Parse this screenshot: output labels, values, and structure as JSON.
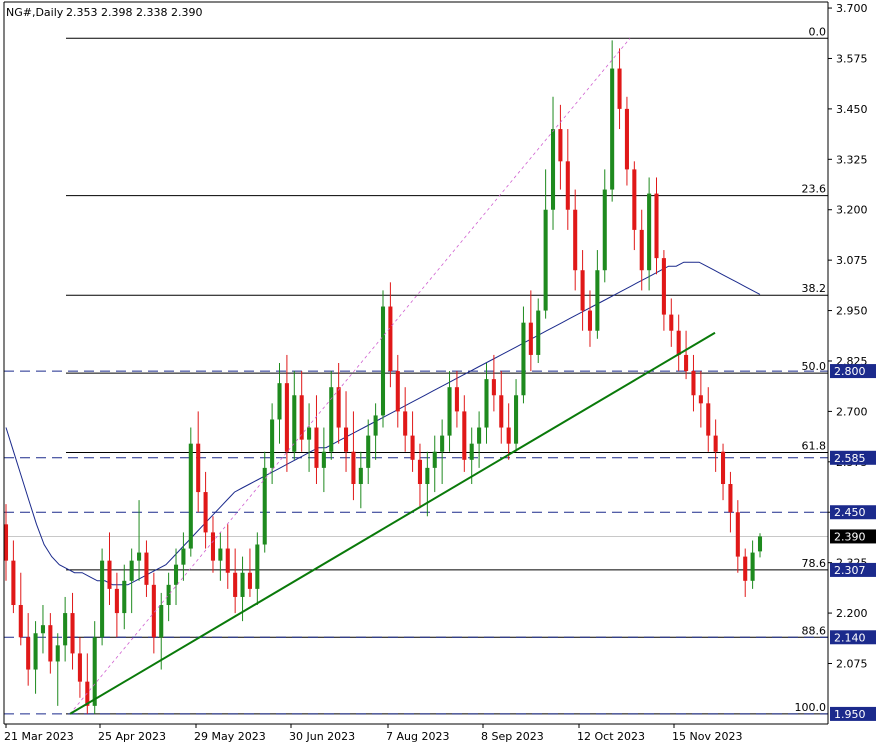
{
  "chart_data": {
    "type": "candlestick",
    "symbol_title": "NG#,Daily",
    "ohlc_readout": "2.353 2.398 2.338 2.390",
    "y_range": [
      1.925,
      3.715
    ],
    "y_ticks": [
      "3.700",
      "3.575",
      "3.450",
      "3.325",
      "3.200",
      "3.075",
      "2.950",
      "2.825",
      "2.700",
      "2.575",
      "2.450",
      "2.325",
      "2.200",
      "2.075"
    ],
    "x_labels": [
      "21 Mar 2023",
      "25 Apr 2023",
      "29 May 2023",
      "30 Jun 2023",
      "7 Aug 2023",
      "8 Sep 2023",
      "12 Oct 2023",
      "15 Nov 2023"
    ],
    "fib_levels": [
      {
        "label": "0.0",
        "price": 3.625
      },
      {
        "label": "23.6",
        "price": 3.235
      },
      {
        "label": "38.2",
        "price": 2.988
      },
      {
        "label": "50.0",
        "price": 2.795
      },
      {
        "label": "61.8",
        "price": 2.598
      },
      {
        "label": "78.6",
        "price": 2.307
      },
      {
        "label": "88.6",
        "price": 2.14
      },
      {
        "label": "100.0",
        "price": 1.95
      }
    ],
    "price_tags": [
      {
        "label": "2.800",
        "price": 2.8,
        "bg": "#1b2a8c"
      },
      {
        "label": "2.585",
        "price": 2.585,
        "bg": "#1b2a8c"
      },
      {
        "label": "2.450",
        "price": 2.45,
        "bg": "#1b2a8c"
      },
      {
        "label": "2.390",
        "price": 2.39,
        "bg": "#000000"
      },
      {
        "label": "2.307",
        "price": 2.307,
        "bg": "#1b2a8c"
      },
      {
        "label": "2.140",
        "price": 2.14,
        "bg": "#1b2a8c"
      },
      {
        "label": "1.950",
        "price": 1.95,
        "bg": "#1b2a8c"
      }
    ],
    "horizontal_dashed": [
      2.8,
      2.585,
      2.45,
      2.14,
      1.95
    ],
    "current_price": 2.39,
    "trendline": {
      "from": {
        "bar": 50,
        "price": 1.95
      },
      "to": {
        "bar": 538,
        "price": 2.895
      }
    },
    "fib_diagonal": {
      "from": {
        "bar": 50,
        "price": 1.95
      },
      "to": {
        "bar": 480,
        "price": 3.625
      }
    },
    "candles": [
      [
        2.42,
        2.47,
        2.28,
        2.33
      ],
      [
        2.33,
        2.38,
        2.2,
        2.22
      ],
      [
        2.22,
        2.3,
        2.12,
        2.14
      ],
      [
        2.14,
        2.2,
        2.02,
        2.06
      ],
      [
        2.06,
        2.18,
        2.0,
        2.15
      ],
      [
        2.15,
        2.22,
        2.1,
        2.17
      ],
      [
        2.17,
        2.2,
        2.05,
        2.08
      ],
      [
        2.08,
        2.15,
        1.97,
        2.12
      ],
      [
        2.12,
        2.24,
        2.08,
        2.2
      ],
      [
        2.2,
        2.25,
        2.06,
        2.1
      ],
      [
        2.1,
        2.14,
        1.99,
        2.03
      ],
      [
        2.03,
        2.1,
        1.95,
        1.97
      ],
      [
        1.97,
        2.18,
        1.95,
        2.14
      ],
      [
        2.14,
        2.36,
        2.12,
        2.33
      ],
      [
        2.33,
        2.4,
        2.22,
        2.26
      ],
      [
        2.26,
        2.3,
        2.14,
        2.2
      ],
      [
        2.2,
        2.32,
        2.16,
        2.28
      ],
      [
        2.28,
        2.36,
        2.2,
        2.33
      ],
      [
        2.33,
        2.48,
        2.28,
        2.35
      ],
      [
        2.35,
        2.38,
        2.24,
        2.27
      ],
      [
        2.27,
        2.3,
        2.1,
        2.14
      ],
      [
        2.14,
        2.25,
        2.06,
        2.22
      ],
      [
        2.22,
        2.3,
        2.18,
        2.27
      ],
      [
        2.27,
        2.36,
        2.22,
        2.32
      ],
      [
        2.32,
        2.4,
        2.28,
        2.36
      ],
      [
        2.36,
        2.66,
        2.34,
        2.62
      ],
      [
        2.62,
        2.7,
        2.45,
        2.5
      ],
      [
        2.5,
        2.55,
        2.36,
        2.4
      ],
      [
        2.4,
        2.44,
        2.3,
        2.33
      ],
      [
        2.33,
        2.4,
        2.28,
        2.36
      ],
      [
        2.36,
        2.42,
        2.26,
        2.3
      ],
      [
        2.3,
        2.36,
        2.2,
        2.24
      ],
      [
        2.24,
        2.34,
        2.18,
        2.3
      ],
      [
        2.3,
        2.36,
        2.24,
        2.26
      ],
      [
        2.26,
        2.4,
        2.22,
        2.37
      ],
      [
        2.37,
        2.6,
        2.35,
        2.56
      ],
      [
        2.56,
        2.72,
        2.52,
        2.68
      ],
      [
        2.68,
        2.82,
        2.62,
        2.77
      ],
      [
        2.77,
        2.84,
        2.55,
        2.6
      ],
      [
        2.6,
        2.8,
        2.58,
        2.74
      ],
      [
        2.74,
        2.8,
        2.6,
        2.63
      ],
      [
        2.63,
        2.72,
        2.55,
        2.66
      ],
      [
        2.66,
        2.74,
        2.52,
        2.56
      ],
      [
        2.56,
        2.66,
        2.5,
        2.6
      ],
      [
        2.6,
        2.8,
        2.58,
        2.76
      ],
      [
        2.76,
        2.82,
        2.62,
        2.66
      ],
      [
        2.66,
        2.75,
        2.55,
        2.6
      ],
      [
        2.6,
        2.7,
        2.48,
        2.52
      ],
      [
        2.52,
        2.6,
        2.46,
        2.56
      ],
      [
        2.56,
        2.68,
        2.52,
        2.64
      ],
      [
        2.64,
        2.72,
        2.58,
        2.69
      ],
      [
        2.69,
        3.0,
        2.66,
        2.96
      ],
      [
        2.96,
        3.02,
        2.76,
        2.8
      ],
      [
        2.8,
        2.84,
        2.66,
        2.7
      ],
      [
        2.7,
        2.76,
        2.6,
        2.64
      ],
      [
        2.64,
        2.7,
        2.55,
        2.58
      ],
      [
        2.58,
        2.62,
        2.46,
        2.52
      ],
      [
        2.52,
        2.6,
        2.44,
        2.56
      ],
      [
        2.56,
        2.64,
        2.5,
        2.6
      ],
      [
        2.6,
        2.68,
        2.52,
        2.64
      ],
      [
        2.64,
        2.8,
        2.6,
        2.76
      ],
      [
        2.76,
        2.8,
        2.66,
        2.7
      ],
      [
        2.7,
        2.74,
        2.55,
        2.58
      ],
      [
        2.58,
        2.66,
        2.52,
        2.62
      ],
      [
        2.62,
        2.7,
        2.56,
        2.66
      ],
      [
        2.66,
        2.82,
        2.62,
        2.78
      ],
      [
        2.78,
        2.84,
        2.7,
        2.74
      ],
      [
        2.74,
        2.8,
        2.62,
        2.66
      ],
      [
        2.66,
        2.72,
        2.58,
        2.62
      ],
      [
        2.62,
        2.78,
        2.6,
        2.74
      ],
      [
        2.74,
        2.96,
        2.72,
        2.92
      ],
      [
        2.92,
        3.0,
        2.8,
        2.84
      ],
      [
        2.84,
        2.98,
        2.82,
        2.95
      ],
      [
        2.95,
        3.3,
        2.93,
        3.2
      ],
      [
        3.2,
        3.48,
        3.15,
        3.4
      ],
      [
        3.4,
        3.46,
        3.25,
        3.32
      ],
      [
        3.32,
        3.4,
        3.15,
        3.2
      ],
      [
        3.2,
        3.25,
        3.0,
        3.05
      ],
      [
        3.05,
        3.1,
        2.9,
        2.95
      ],
      [
        2.95,
        3.0,
        2.86,
        2.9
      ],
      [
        2.9,
        3.1,
        2.88,
        3.05
      ],
      [
        3.05,
        3.3,
        3.02,
        3.25
      ],
      [
        3.25,
        3.62,
        3.22,
        3.55
      ],
      [
        3.55,
        3.6,
        3.4,
        3.45
      ],
      [
        3.45,
        3.48,
        3.26,
        3.3
      ],
      [
        3.3,
        3.32,
        3.1,
        3.15
      ],
      [
        3.15,
        3.2,
        3.0,
        3.05
      ],
      [
        3.05,
        3.28,
        3.0,
        3.24
      ],
      [
        3.24,
        3.28,
        3.04,
        3.08
      ],
      [
        3.08,
        3.1,
        2.9,
        2.94
      ],
      [
        2.94,
        2.98,
        2.86,
        2.9
      ],
      [
        2.9,
        2.94,
        2.8,
        2.84
      ],
      [
        2.84,
        2.9,
        2.78,
        2.8
      ],
      [
        2.8,
        2.84,
        2.7,
        2.74
      ],
      [
        2.74,
        2.8,
        2.66,
        2.72
      ],
      [
        2.72,
        2.76,
        2.6,
        2.64
      ],
      [
        2.64,
        2.68,
        2.55,
        2.6
      ],
      [
        2.6,
        2.62,
        2.48,
        2.52
      ],
      [
        2.52,
        2.55,
        2.4,
        2.45
      ],
      [
        2.45,
        2.48,
        2.3,
        2.34
      ],
      [
        2.34,
        2.36,
        2.24,
        2.28
      ],
      [
        2.28,
        2.38,
        2.26,
        2.35
      ],
      [
        2.353,
        2.398,
        2.338,
        2.39
      ]
    ],
    "ma": [
      2.66,
      2.6,
      2.54,
      2.48,
      2.42,
      2.37,
      2.34,
      2.32,
      2.31,
      2.3,
      2.3,
      2.29,
      2.28,
      2.28,
      2.27,
      2.27,
      2.27,
      2.28,
      2.29,
      2.3,
      2.31,
      2.32,
      2.34,
      2.36,
      2.38,
      2.4,
      2.42,
      2.44,
      2.46,
      2.48,
      2.5,
      2.51,
      2.52,
      2.53,
      2.54,
      2.55,
      2.56,
      2.57,
      2.58,
      2.59,
      2.6,
      2.61,
      2.61,
      2.62,
      2.63,
      2.64,
      2.65,
      2.66,
      2.67,
      2.68,
      2.69,
      2.7,
      2.71,
      2.72,
      2.73,
      2.74,
      2.75,
      2.76,
      2.77,
      2.78,
      2.79,
      2.8,
      2.81,
      2.82,
      2.83,
      2.84,
      2.85,
      2.86,
      2.87,
      2.88,
      2.89,
      2.9,
      2.91,
      2.92,
      2.93,
      2.94,
      2.95,
      2.96,
      2.97,
      2.98,
      2.99,
      3.0,
      3.01,
      3.02,
      3.03,
      3.04,
      3.05,
      3.06,
      3.06,
      3.07,
      3.07,
      3.07,
      3.06,
      3.05,
      3.04,
      3.03,
      3.02,
      3.01,
      3.0,
      2.99
    ]
  }
}
